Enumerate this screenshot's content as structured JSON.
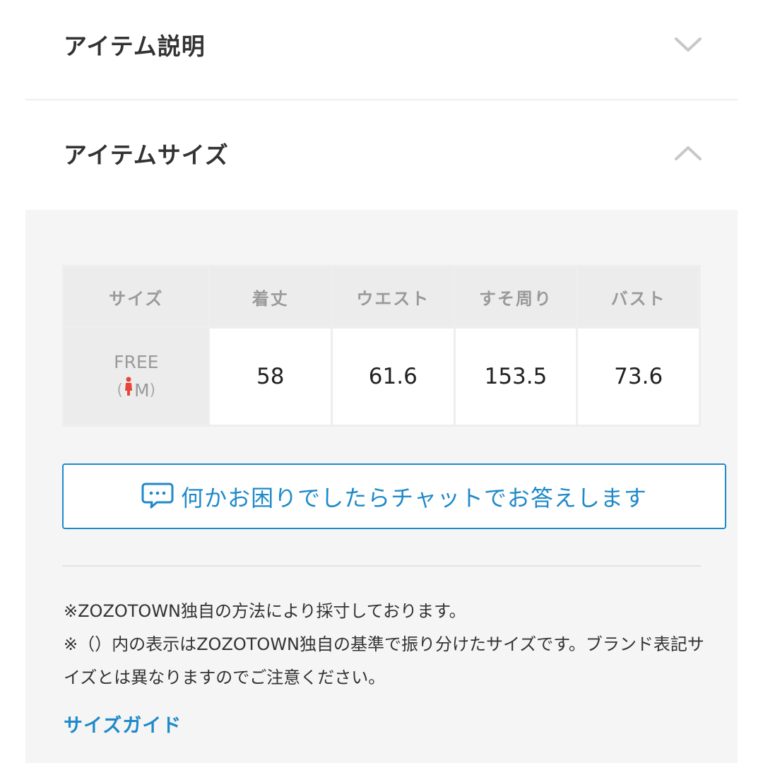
{
  "accordion": {
    "description": {
      "title": "アイテム説明",
      "state": "collapsed",
      "icon": "chevron-down-icon"
    },
    "size": {
      "title": "アイテムサイズ",
      "state": "expanded",
      "icon": "chevron-up-icon"
    }
  },
  "size_table": {
    "headers": [
      "サイズ",
      "着丈",
      "ウエスト",
      "すそ周り",
      "バスト"
    ],
    "rows": [
      {
        "size": "FREE",
        "size_sub_open": "(",
        "size_sub": "M",
        "size_sub_close": ")",
        "size_sub_icon": "female-person-icon",
        "values": [
          "58",
          "61.6",
          "153.5",
          "73.6"
        ]
      }
    ]
  },
  "chat_button": {
    "label": "何かお困りでしたらチャットでお答えします",
    "icon": "chat-bubble-icon"
  },
  "notes": [
    "※ZOZOTOWN独自の方法により採寸しております。",
    "※（）内の表示はZOZOTOWN独自の基準で振り分けたサイズです。ブランド表記サイズとは異なりますのでご注意ください。"
  ],
  "size_guide": {
    "label": "サイズガイド"
  },
  "colors": {
    "accent": "#1f8ac9",
    "female_icon": "#e8443a",
    "header_bg": "#ececec",
    "panel_bg": "#f5f5f5"
  }
}
